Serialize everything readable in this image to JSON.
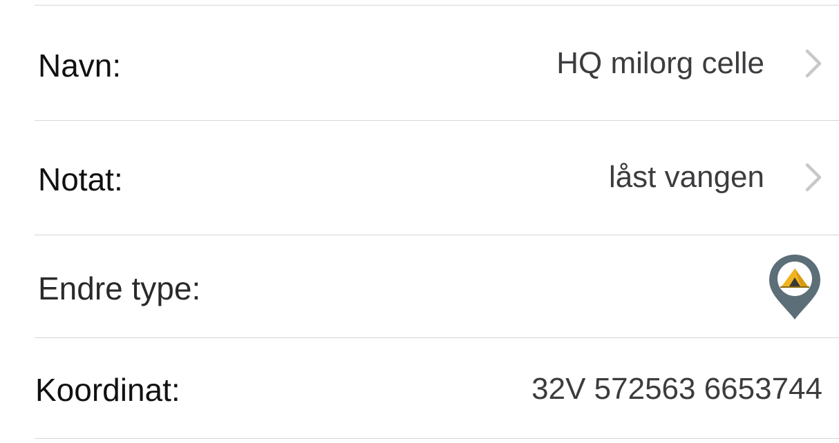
{
  "rows": [
    {
      "label": "Navn:",
      "value": "HQ milorg celle",
      "chevron": "chevron-right-icon"
    },
    {
      "label": "Notat:",
      "value": "låst vangen",
      "chevron": "chevron-right-icon"
    },
    {
      "label": "Endre type:",
      "icon": "tent-marker-icon"
    },
    {
      "label": "Koordinat:",
      "value": "32V 572563 6653744"
    }
  ],
  "colors": {
    "divider": "#d5d5d8",
    "label_text": "#111111",
    "value_text": "#3c3c3f",
    "chevron": "#c7c7cc",
    "pin_body": "#5c6e77",
    "tent": "#f2b320"
  }
}
